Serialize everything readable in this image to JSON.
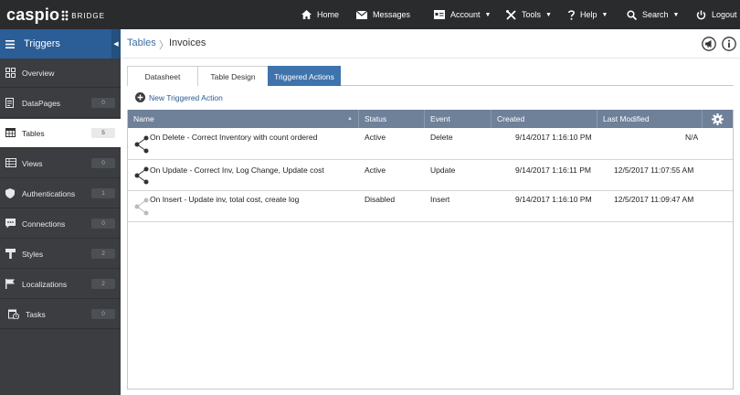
{
  "topbar": {
    "brand": "caspio",
    "brand_suffix": "BRIDGE",
    "nav": [
      {
        "label": "Home",
        "icon": "home-icon"
      },
      {
        "label": "Messages",
        "icon": "envelope-icon"
      },
      {
        "label": "Account",
        "icon": "account-icon",
        "caret": "▼"
      },
      {
        "label": "Tools",
        "icon": "tools-icon",
        "caret": "▼"
      },
      {
        "label": "Help",
        "icon": "help-icon",
        "caret": "▼"
      },
      {
        "label": "Search",
        "icon": "search-icon",
        "caret": "▼"
      },
      {
        "label": "Logout",
        "icon": "power-icon"
      }
    ]
  },
  "sidebar": {
    "title": "Triggers",
    "collapse_glyph": "◀",
    "items": [
      {
        "label": "Overview",
        "badge": "",
        "icon": "overview-icon"
      },
      {
        "label": "DataPages",
        "badge": "0",
        "icon": "datapages-icon"
      },
      {
        "label": "Tables",
        "badge": "5",
        "icon": "tables-icon",
        "active": true
      },
      {
        "label": "Views",
        "badge": "0",
        "icon": "views-icon"
      },
      {
        "label": "Authentications",
        "badge": "1",
        "icon": "shield-icon"
      },
      {
        "label": "Connections",
        "badge": "0",
        "icon": "connections-icon"
      },
      {
        "label": "Styles",
        "badge": "2",
        "icon": "styles-icon"
      },
      {
        "label": "Localizations",
        "badge": "2",
        "icon": "flag-icon"
      },
      {
        "label": "Tasks",
        "badge": "0",
        "icon": "tasks-icon"
      }
    ]
  },
  "breadcrumb": {
    "parent": "Tables",
    "separator": "〉",
    "current": "Invoices"
  },
  "tabs": [
    {
      "label": "Datasheet"
    },
    {
      "label": "Table Design"
    },
    {
      "label": "Triggered Actions",
      "active": true
    }
  ],
  "new_action_label": "New Triggered Action",
  "grid": {
    "sort_glyph": "▲",
    "columns": [
      "Name",
      "Status",
      "Event",
      "Created",
      "Last Modified"
    ],
    "rows": [
      {
        "name": "On Delete - Correct Inventory with count ordered",
        "status": "Active",
        "event": "Delete",
        "created": "9/14/2017 1:16:10 PM",
        "modified": "N/A",
        "enabled": true
      },
      {
        "name": "On Update - Correct Inv, Log Change, Update cost",
        "status": "Active",
        "event": "Update",
        "created": "9/14/2017 1:16:11 PM",
        "modified": "12/5/2017 11:07:55 AM",
        "enabled": true
      },
      {
        "name": "On Insert - Update inv, total cost, create log",
        "status": "Disabled",
        "event": "Insert",
        "created": "9/14/2017 1:16:10 PM",
        "modified": "12/5/2017 11:09:47 AM",
        "enabled": false
      }
    ]
  },
  "colors": {
    "topbar": "#2a2b2d",
    "sidebar": "#3b3d40",
    "accent": "#2b5d97",
    "grid_header": "#6f8099"
  }
}
